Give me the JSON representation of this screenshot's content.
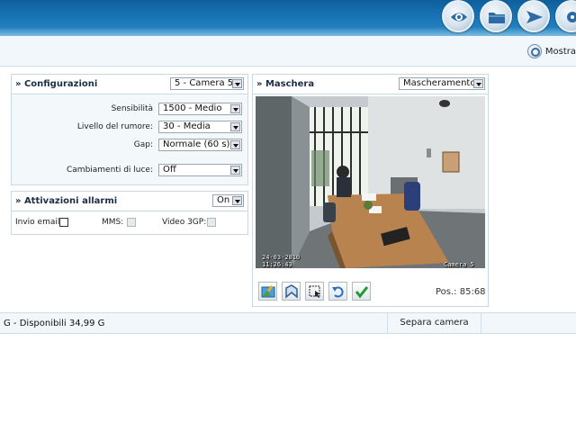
{
  "header": {
    "buttons": [
      {
        "icon": "eye-icon"
      },
      {
        "icon": "folder-icon"
      },
      {
        "icon": "send-icon"
      },
      {
        "icon": "settings-icon"
      }
    ],
    "show_label": "Mostra"
  },
  "config": {
    "title": "» Configurazioni",
    "camera_select": "5 - Camera 5",
    "rows": [
      {
        "label": "Sensibilità",
        "value": "1500 - Medio"
      },
      {
        "label": "Livello del rumore:",
        "value": "30 - Media"
      },
      {
        "label": "Gap:",
        "value": "Normale (60 s)"
      },
      {
        "label": "Cambiamenti di luce:",
        "value": "Off"
      }
    ]
  },
  "alarms": {
    "title": "» Attivazioni allarmi",
    "state": "On",
    "email_label": "Invio email:",
    "mms_label": "MMS:",
    "video_label": "Video 3GP:"
  },
  "mask": {
    "title": "» Maschera",
    "mode_select": "Mascheramento",
    "timestamp_date": "24-03-2010",
    "timestamp_time": "11:26:43",
    "camera_label": "Camera 5",
    "pos_label": "Pos.: 85:68",
    "tools": [
      {
        "icon": "image-edit-icon"
      },
      {
        "icon": "polygon-icon"
      },
      {
        "icon": "select-area-icon"
      },
      {
        "icon": "undo-icon"
      },
      {
        "icon": "confirm-check-icon"
      }
    ]
  },
  "footer": {
    "disk_text": "G - Disponibili 34,99 G",
    "separate_label": "Separa camera"
  },
  "colors": {
    "banner": "#1c78b8",
    "panel_border": "#c9d9e3",
    "form_bg": "#f3f8fa"
  }
}
